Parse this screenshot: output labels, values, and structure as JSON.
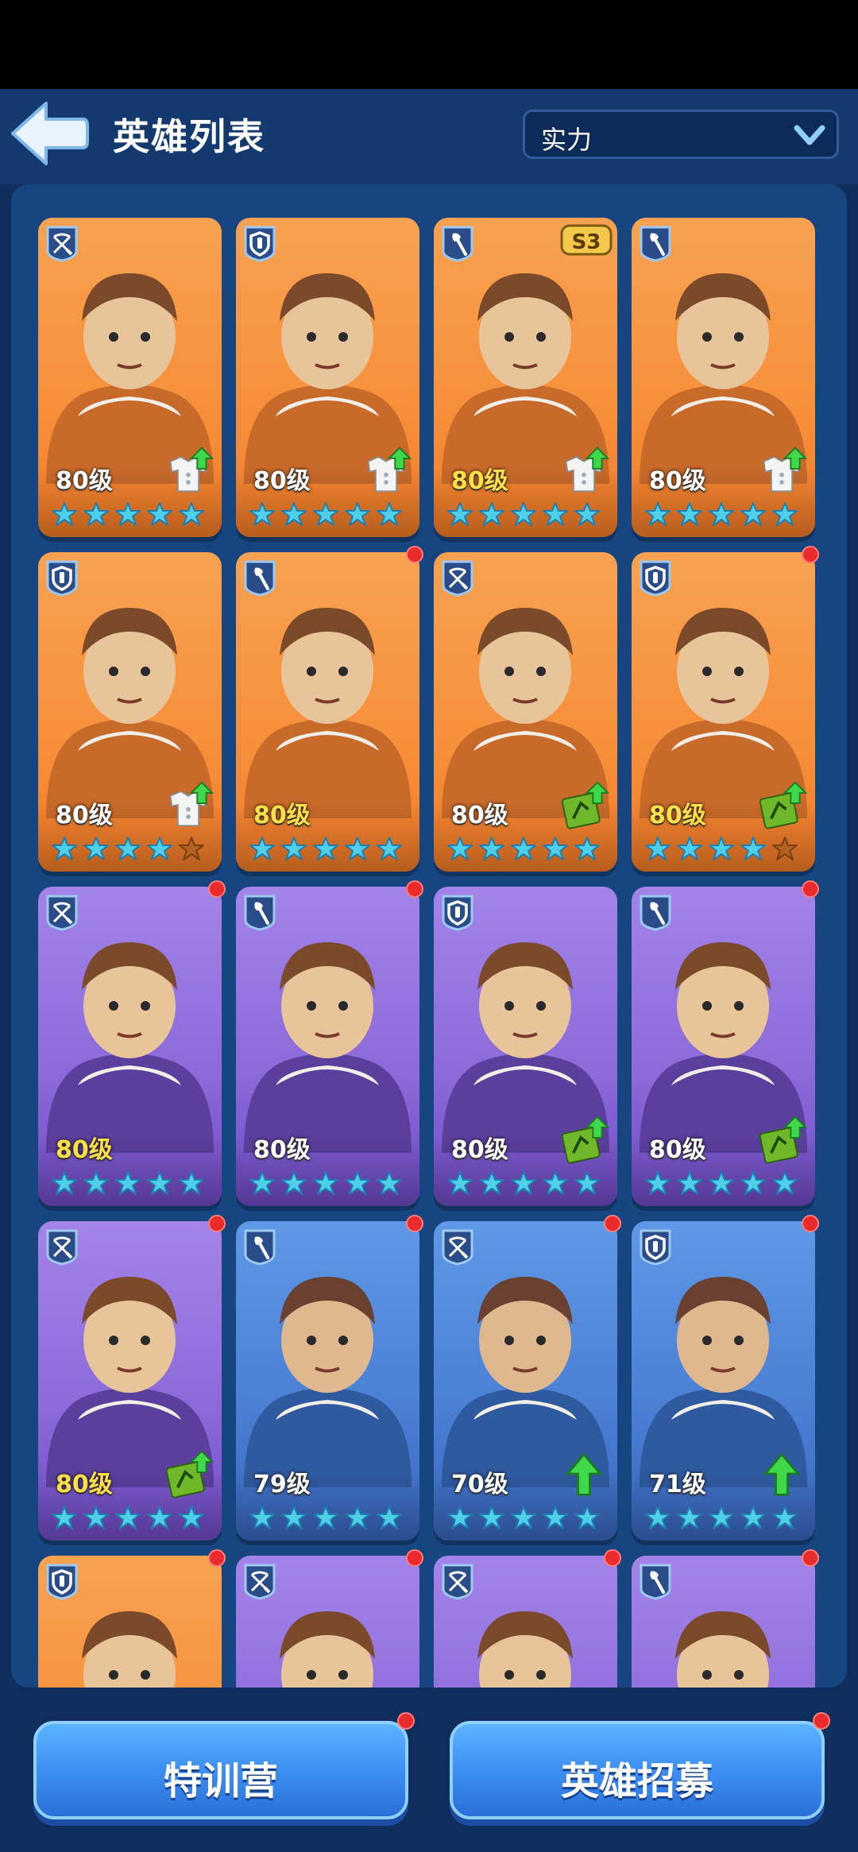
{
  "header": {
    "title": "英雄列表",
    "sort_selected": "实力"
  },
  "colors": {
    "card_orange": "#f78f3a",
    "card_purple": "#8b69d9",
    "card_blue": "#4a7fd4",
    "notification_dot": "#ea2b2b",
    "star": "#4fd0e8",
    "star_empty": "#b3631f",
    "level_gold": "#ffe04a"
  },
  "heroes": [
    {
      "level": "80级",
      "rarity": "orange",
      "class_icon": "crossbow-icon",
      "stars_filled": 5,
      "upgrade": "outfit-upgrade-icon",
      "notify": false,
      "gold": false
    },
    {
      "level": "80级",
      "rarity": "orange",
      "class_icon": "shield-icon",
      "stars_filled": 5,
      "upgrade": "outfit-upgrade-icon",
      "notify": false,
      "gold": false
    },
    {
      "level": "80级",
      "rarity": "orange",
      "class_icon": "shovel-icon",
      "stars_filled": 5,
      "upgrade": "outfit-upgrade-icon",
      "notify": false,
      "gold": true,
      "season": "S3"
    },
    {
      "level": "80级",
      "rarity": "orange",
      "class_icon": "shovel-icon",
      "stars_filled": 5,
      "upgrade": "outfit-upgrade-icon",
      "notify": false,
      "gold": false
    },
    {
      "level": "80级",
      "rarity": "orange",
      "class_icon": "shield-icon",
      "stars_filled": 4,
      "upgrade": "outfit-upgrade-icon",
      "notify": false,
      "gold": false
    },
    {
      "level": "80级",
      "rarity": "orange",
      "class_icon": "shovel-icon",
      "stars_filled": 5,
      "upgrade": "",
      "notify": true,
      "gold": true
    },
    {
      "level": "80级",
      "rarity": "orange",
      "class_icon": "crossbow-icon",
      "stars_filled": 5,
      "upgrade": "manual-upgrade-icon",
      "notify": false,
      "gold": false
    },
    {
      "level": "80级",
      "rarity": "orange",
      "class_icon": "shield-icon",
      "stars_filled": 4,
      "upgrade": "manual-upgrade-icon",
      "notify": true,
      "gold": true
    },
    {
      "level": "80级",
      "rarity": "purple",
      "class_icon": "crossbow-icon",
      "stars_filled": 5,
      "upgrade": "",
      "notify": true,
      "gold": true
    },
    {
      "level": "80级",
      "rarity": "purple",
      "class_icon": "shovel-icon",
      "stars_filled": 5,
      "upgrade": "",
      "notify": true,
      "gold": false
    },
    {
      "level": "80级",
      "rarity": "purple",
      "class_icon": "shield-icon",
      "stars_filled": 5,
      "upgrade": "manual-upgrade-icon",
      "notify": false,
      "gold": false
    },
    {
      "level": "80级",
      "rarity": "purple",
      "class_icon": "shovel-icon",
      "stars_filled": 5,
      "upgrade": "manual-upgrade-icon",
      "notify": true,
      "gold": false
    },
    {
      "level": "80级",
      "rarity": "purple",
      "class_icon": "crossbow-icon",
      "stars_filled": 5,
      "upgrade": "manual-upgrade-icon",
      "notify": true,
      "gold": true
    },
    {
      "level": "79级",
      "rarity": "blue",
      "class_icon": "shovel-icon",
      "stars_filled": 5,
      "upgrade": "",
      "notify": true,
      "gold": false
    },
    {
      "level": "70级",
      "rarity": "blue",
      "class_icon": "crossbow-icon",
      "stars_filled": 5,
      "upgrade": "level-up-arrow-icon",
      "notify": true,
      "gold": false
    },
    {
      "level": "71级",
      "rarity": "blue",
      "class_icon": "shield-icon",
      "stars_filled": 5,
      "upgrade": "level-up-arrow-icon",
      "notify": true,
      "gold": false
    },
    {
      "level": "",
      "rarity": "orange",
      "class_icon": "shield-icon",
      "stars_filled": 0,
      "upgrade": "",
      "notify": true,
      "gold": false
    },
    {
      "level": "",
      "rarity": "purple",
      "class_icon": "crossbow-icon",
      "stars_filled": 0,
      "upgrade": "",
      "notify": true,
      "gold": false
    },
    {
      "level": "",
      "rarity": "purple",
      "class_icon": "crossbow-icon",
      "stars_filled": 0,
      "upgrade": "",
      "notify": true,
      "gold": false
    },
    {
      "level": "",
      "rarity": "purple",
      "class_icon": "shovel-icon",
      "stars_filled": 0,
      "upgrade": "",
      "notify": true,
      "gold": false
    }
  ],
  "footer": {
    "training_label": "特训营",
    "recruit_label": "英雄招募"
  }
}
